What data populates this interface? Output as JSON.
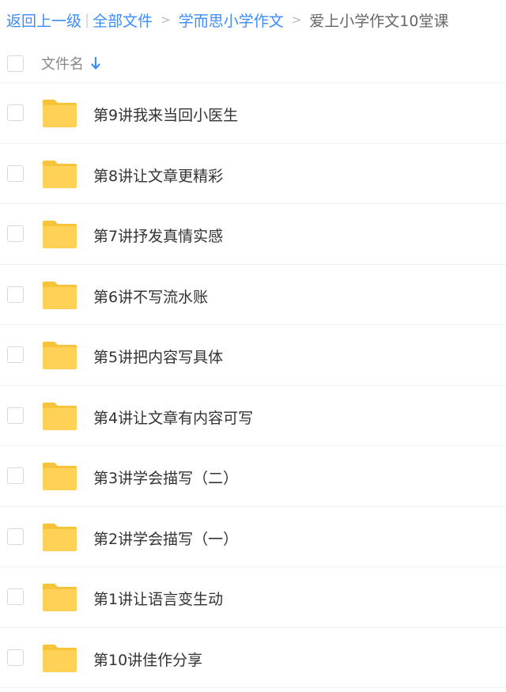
{
  "breadcrumb": {
    "back": "返回上一级",
    "separator": "|",
    "all_files": "全部文件",
    "arrow": ">",
    "parent": "学而思小学作文",
    "current": "爱上小学作文10堂课"
  },
  "header": {
    "name_label": "文件名",
    "sort_icon": "arrow-down-icon"
  },
  "colors": {
    "accent": "#3b8cff",
    "folder": "#ffd257",
    "folder_tab": "#f7c33a"
  },
  "files": [
    {
      "name": "第9讲我来当回小医生",
      "icon": "folder-icon"
    },
    {
      "name": "第8讲让文章更精彩",
      "icon": "folder-icon"
    },
    {
      "name": "第7讲抒发真情实感",
      "icon": "folder-icon"
    },
    {
      "name": "第6讲不写流水账",
      "icon": "folder-icon"
    },
    {
      "name": "第5讲把内容写具体",
      "icon": "folder-icon"
    },
    {
      "name": "第4讲让文章有内容可写",
      "icon": "folder-icon"
    },
    {
      "name": "第3讲学会描写（二）",
      "icon": "folder-icon"
    },
    {
      "name": "第2讲学会描写（一）",
      "icon": "folder-icon"
    },
    {
      "name": "第1讲让语言变生动",
      "icon": "folder-icon"
    },
    {
      "name": "第10讲佳作分享",
      "icon": "folder-icon"
    }
  ]
}
